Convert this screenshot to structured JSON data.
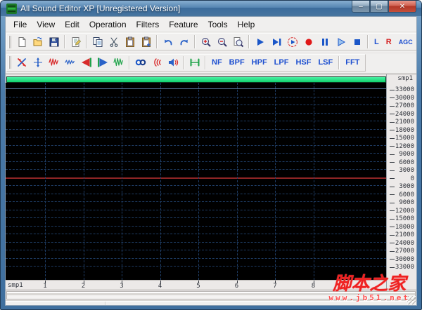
{
  "window": {
    "title": "All Sound Editor XP [Unregistered Version]",
    "controls": {
      "minimize": "–",
      "maximize": "▢",
      "close": "✕"
    }
  },
  "menu_bar": {
    "items": [
      "File",
      "View",
      "Edit",
      "Operation",
      "Filters",
      "Feature",
      "Tools",
      "Help"
    ]
  },
  "toolbar_main": {
    "items": [
      {
        "icon": "new-file"
      },
      {
        "icon": "open-file"
      },
      {
        "icon": "save"
      },
      {
        "sep": true
      },
      {
        "icon": "file-properties"
      },
      {
        "sep": true
      },
      {
        "icon": "copy"
      },
      {
        "icon": "cut"
      },
      {
        "icon": "paste"
      },
      {
        "icon": "paste-insert"
      },
      {
        "sep": true
      },
      {
        "icon": "undo"
      },
      {
        "icon": "redo"
      },
      {
        "sep": true
      },
      {
        "icon": "zoom-in"
      },
      {
        "icon": "zoom-out"
      },
      {
        "icon": "zoom-fit"
      },
      {
        "sep": true
      },
      {
        "icon": "play"
      },
      {
        "icon": "play-to-end"
      },
      {
        "icon": "loop-play"
      },
      {
        "icon": "record"
      },
      {
        "icon": "pause"
      },
      {
        "icon": "play-selection"
      },
      {
        "icon": "stop"
      },
      {
        "sep": true
      },
      {
        "text": "L",
        "name": "left-channel",
        "color": "#1d4fd0"
      },
      {
        "text": "R",
        "name": "right-channel",
        "color": "#d42020"
      },
      {
        "text": "AGC",
        "name": "agc",
        "color": "#1d4fd0",
        "small": true
      }
    ]
  },
  "toolbar_effects": {
    "items": [
      {
        "icon": "swap-channels"
      },
      {
        "icon": "center-channel"
      },
      {
        "icon": "amplify"
      },
      {
        "icon": "attenuate"
      },
      {
        "icon": "fade-in"
      },
      {
        "icon": "fade-out"
      },
      {
        "icon": "normalize"
      },
      {
        "sep": true
      },
      {
        "icon": "loop"
      },
      {
        "icon": "echo"
      },
      {
        "icon": "volume"
      },
      {
        "sep": true
      },
      {
        "icon": "trim"
      },
      {
        "sep": true
      },
      {
        "text": "NF",
        "name": "nf-filter",
        "color": "#1d4fd0"
      },
      {
        "text": "BPF",
        "name": "bpf-filter",
        "color": "#1d4fd0"
      },
      {
        "text": "HPF",
        "name": "hpf-filter",
        "color": "#1d4fd0"
      },
      {
        "text": "LPF",
        "name": "lpf-filter",
        "color": "#1d4fd0"
      },
      {
        "text": "HSF",
        "name": "hsf-filter",
        "color": "#1d4fd0"
      },
      {
        "text": "LSF",
        "name": "lsf-filter",
        "color": "#1d4fd0"
      },
      {
        "sep": true
      },
      {
        "text": "FFT",
        "name": "fft",
        "color": "#1d4fd0"
      }
    ]
  },
  "editor": {
    "top_channel_label": "smp1",
    "background_color": "#000000",
    "grid_color": "#1e3c64",
    "zero_line_color": "#8e2525",
    "position_bar_color": "#12d46e",
    "amplitude_ticks": [
      "33000",
      "30000",
      "27000",
      "24000",
      "21000",
      "18000",
      "15000",
      "12000",
      "9000",
      "6000",
      "3000",
      "0",
      "3000",
      "6000",
      "9000",
      "12000",
      "15000",
      "18000",
      "21000",
      "24000",
      "27000",
      "30000",
      "33000"
    ],
    "ruler": {
      "label": "smp1",
      "ticks": [
        "1",
        "2",
        "3",
        "4",
        "5",
        "6",
        "7",
        "8"
      ]
    }
  },
  "watermark": {
    "title": "脚本之家",
    "url": "www.jb51.net"
  }
}
